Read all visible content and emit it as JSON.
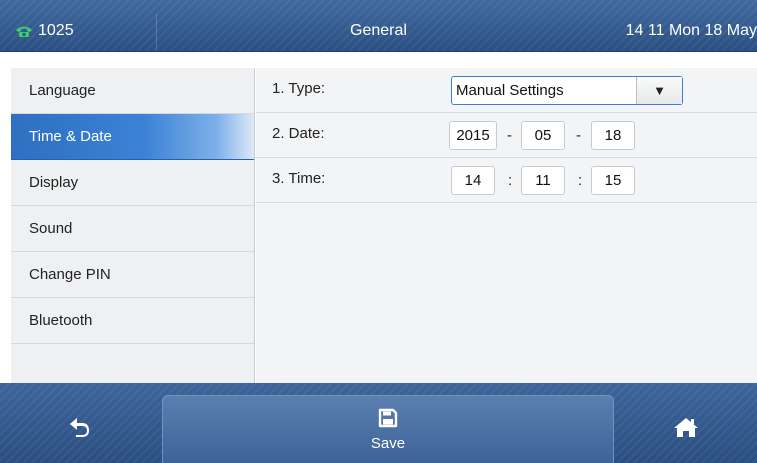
{
  "status_bar": {
    "account": "1025",
    "title": "General",
    "datetime": "14 11 Mon 18 May"
  },
  "sidebar": {
    "items": [
      {
        "label": "Language"
      },
      {
        "label": "Time & Date",
        "active": true
      },
      {
        "label": "Display"
      },
      {
        "label": "Sound"
      },
      {
        "label": "Change PIN"
      },
      {
        "label": "Bluetooth"
      }
    ]
  },
  "settings": {
    "type": {
      "label": "1. Type:",
      "value": "Manual Settings",
      "dropdown_icon": "▼"
    },
    "date": {
      "label": "2. Date:",
      "year": "2015",
      "month": "05",
      "day": "18",
      "separator": "-"
    },
    "time": {
      "label": "3. Time:",
      "hour": "14",
      "minute": "11",
      "second": "15",
      "separator": ":"
    }
  },
  "softkeys": {
    "back_icon": "back-arrow-icon",
    "save_label": "Save",
    "save_icon": "floppy-disk-icon",
    "home_icon": "home-icon"
  },
  "colors": {
    "bar_blue": "#2b4f82",
    "accent_blue": "#3b82d6",
    "phone_green": "#3ecf6a"
  }
}
